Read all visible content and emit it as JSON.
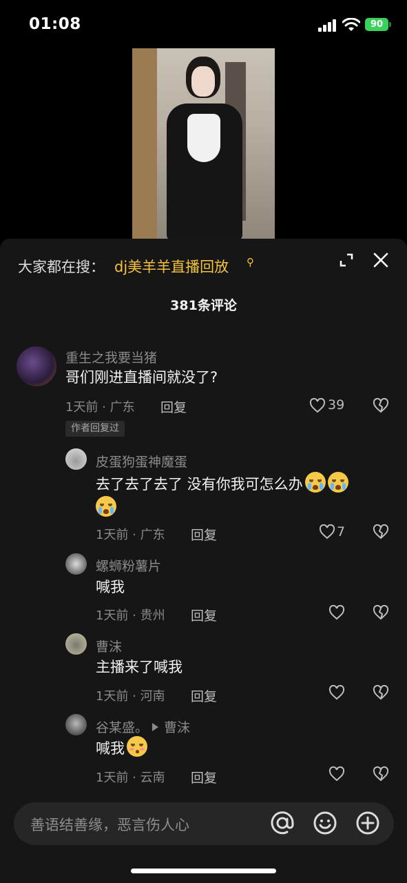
{
  "status": {
    "time": "01:08",
    "battery": "90"
  },
  "search": {
    "prefix": "大家都在搜：",
    "term": "dj美羊羊直播回放"
  },
  "comments_count": "381条评论",
  "comments": [
    {
      "name": "重生之我要当猪",
      "text": "哥们刚进直播间就没了?",
      "meta": "1天前 · 广东",
      "reply": "回复",
      "likes": "39",
      "tag": "作者回复过"
    },
    {
      "name": "皮蛋狗蛋神魔蛋",
      "text": "去了去了去了  没有你我可怎么办",
      "meta": "1天前 · 广东",
      "reply": "回复",
      "likes": "7"
    },
    {
      "name": "螺蛳粉薯片",
      "text": "喊我",
      "meta": "1天前 · 贵州",
      "reply": "回复"
    },
    {
      "name": "曹沫",
      "text": "主播来了喊我",
      "meta": "1天前 · 河南",
      "reply": "回复"
    },
    {
      "name": "谷某盛。",
      "reply_to": "曹沫",
      "text": "喊我",
      "meta": "1天前 · 云南",
      "reply": "回复"
    }
  ],
  "input": {
    "placeholder": "善语结善缘，恶言伤人心"
  }
}
